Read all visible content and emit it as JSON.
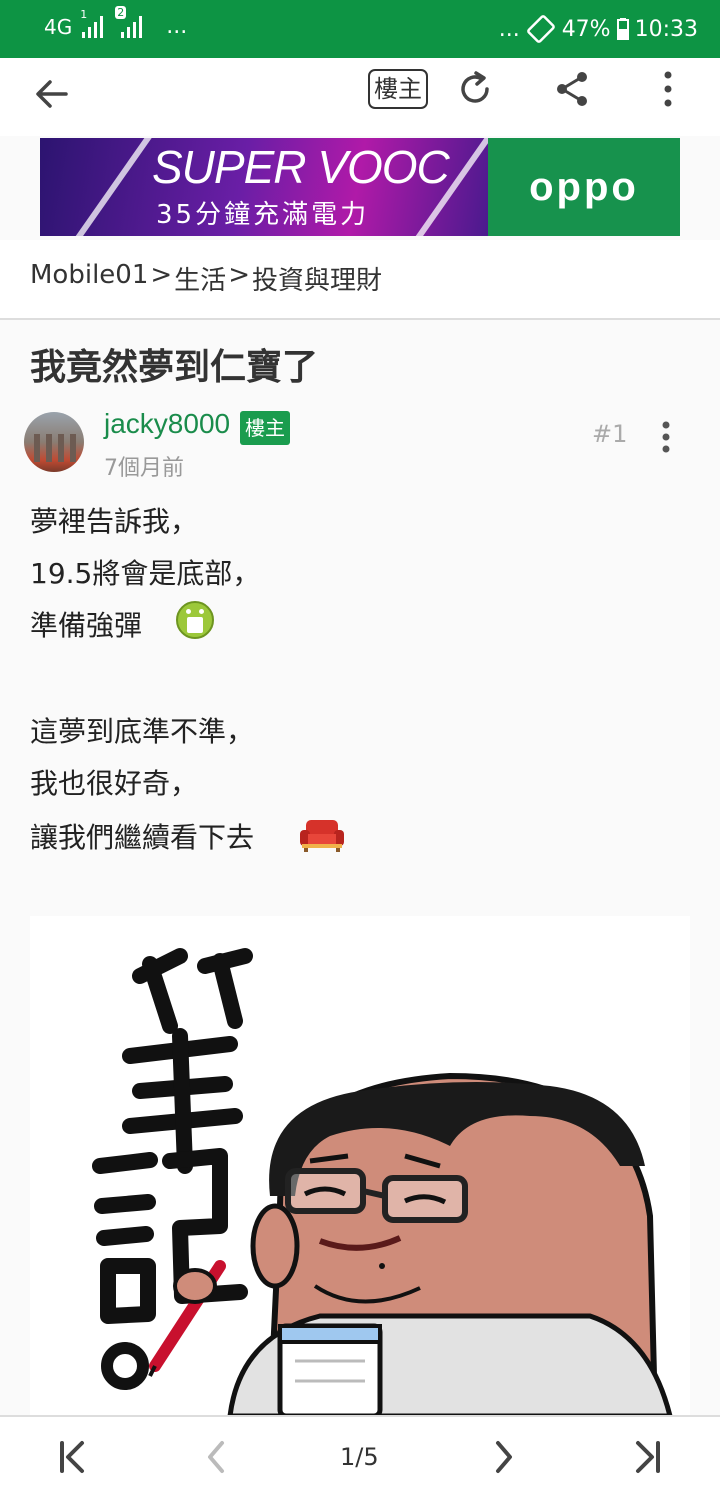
{
  "status_bar": {
    "network": "4G",
    "sim1": "1",
    "sim2": "2",
    "left_dots": "...",
    "right_dots": "...",
    "battery": "47%",
    "time": "10:33"
  },
  "toolbar": {
    "owner_label": "樓主"
  },
  "ad": {
    "headline": "SUPER VOOC",
    "subline": "35分鐘充滿電力",
    "brand": "oppo"
  },
  "breadcrumb": {
    "items": [
      "Mobile01",
      "生活",
      "投資與理財"
    ],
    "separator": ">"
  },
  "thread": {
    "title": "我竟然夢到仁寶了"
  },
  "post": {
    "author": "jacky8000",
    "badge": "樓主",
    "date": "7個月前",
    "floor": "#1",
    "lines": [
      "夢裡告訴我，",
      "19.5將會是底部，",
      "準備強彈",
      "這夢到底準不準，",
      "我也很好奇，",
      "讓我們繼續看下去"
    ],
    "sticker_text": "筆記。"
  },
  "pagination": {
    "label": "1/5"
  },
  "colors": {
    "status_bar": "#0d9444",
    "author": "#1a8c4b",
    "badge": "#1a9c4e"
  },
  "icons": [
    "back-icon",
    "refresh-icon",
    "share-icon",
    "more-icon",
    "first-page-icon",
    "prev-page-icon",
    "next-page-icon",
    "last-page-icon"
  ]
}
